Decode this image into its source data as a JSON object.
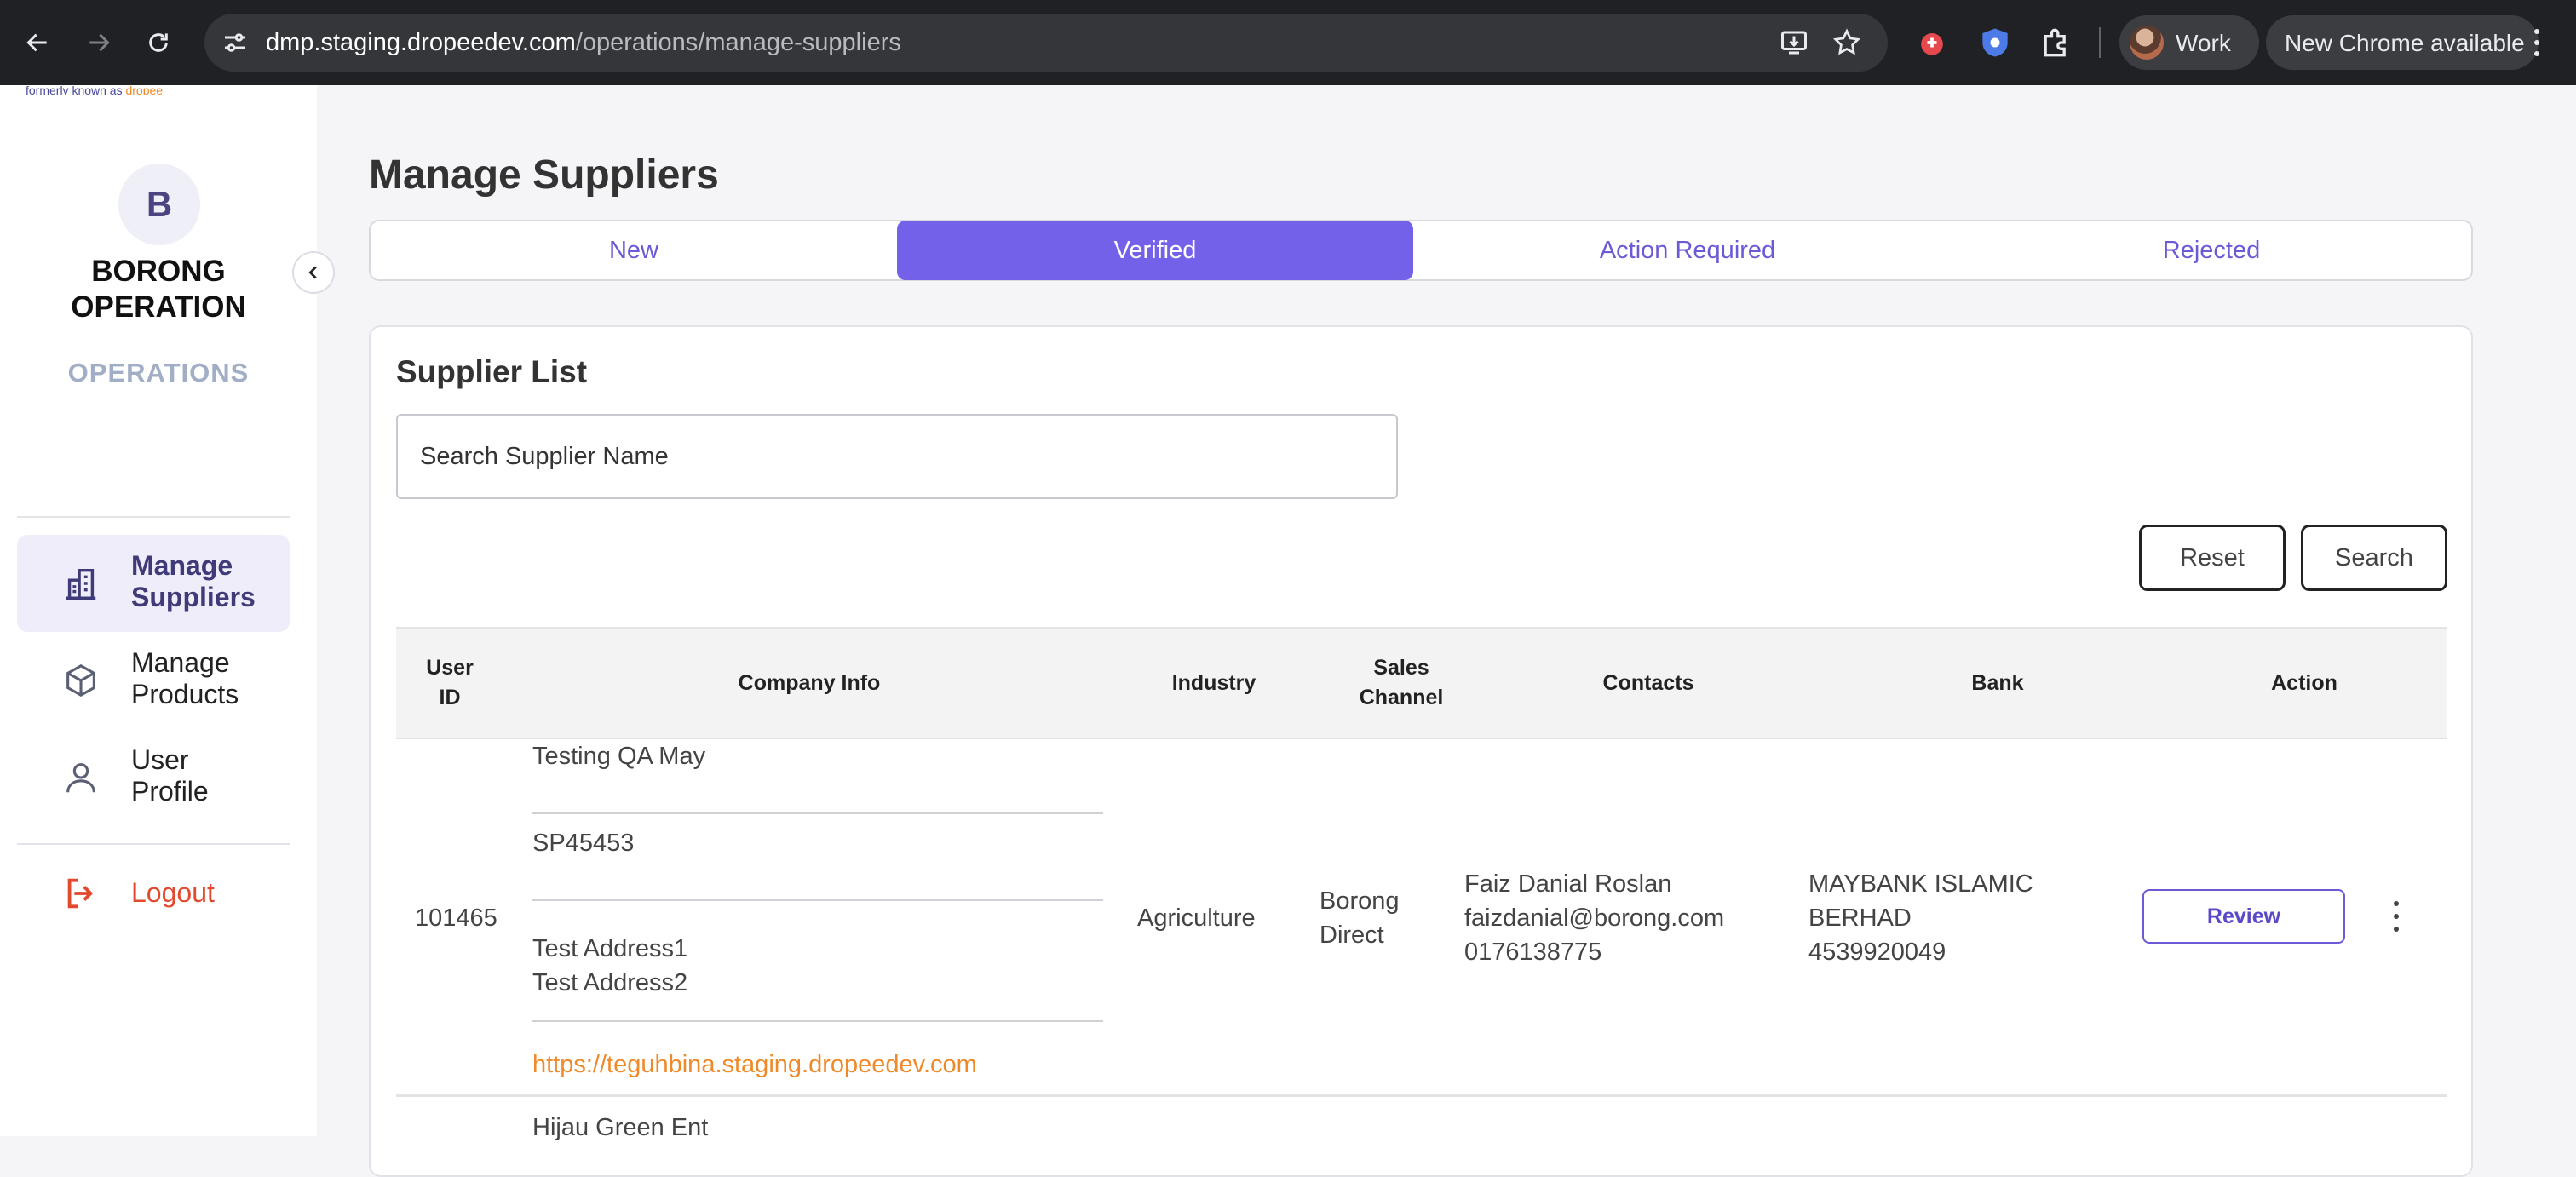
{
  "browser": {
    "url_host": "dmp.staging.dropeedev.com",
    "url_path": "/operations/manage-suppliers",
    "profile_label": "Work",
    "update_label": "New Chrome available"
  },
  "sidebar": {
    "formerly_text": "formerly known as",
    "formerly_brand": "dropee",
    "avatar_letter": "B",
    "org_name_line1": "BORONG",
    "org_name_line2": "OPERATION",
    "org_role": "OPERATIONS",
    "items": [
      {
        "line1": "Manage",
        "line2": "Suppliers",
        "icon": "building-icon",
        "active": true
      },
      {
        "line1": "Manage",
        "line2": "Products",
        "icon": "box-icon",
        "active": false
      },
      {
        "line1": "User",
        "line2": "Profile",
        "icon": "user-icon",
        "active": false
      }
    ],
    "logout_label": "Logout"
  },
  "main": {
    "title": "Manage Suppliers",
    "tabs": [
      "New",
      "Verified",
      "Action Required",
      "Rejected"
    ],
    "active_tab": "Verified",
    "card_title": "Supplier List",
    "search_placeholder": "Search Supplier Name",
    "reset_label": "Reset",
    "search_label": "Search"
  },
  "table": {
    "headers": {
      "user_id_1": "User",
      "user_id_2": "ID",
      "company": "Company Info",
      "industry": "Industry",
      "sales_1": "Sales",
      "sales_2": "Channel",
      "contacts": "Contacts",
      "bank": "Bank",
      "action": "Action"
    },
    "rows": [
      {
        "user_id": "101465",
        "company_name": "Testing QA May",
        "company_code": "SP45453",
        "address_1": "Test Address1",
        "address_2": "Test Address2",
        "website": "https://teguhbina.staging.dropeedev.com",
        "industry": "Agriculture",
        "sales_1": "Borong",
        "sales_2": "Direct",
        "contact_name": "Faiz Danial Roslan",
        "contact_email": "faizdanial@borong.com",
        "contact_phone": "0176138775",
        "bank_1": "MAYBANK ISLAMIC",
        "bank_2": "BERHAD",
        "bank_account": "4539920049",
        "action_label": "Review"
      }
    ],
    "next_row_company": "Hijau Green Ent"
  },
  "colors": {
    "accent": "#7461ea",
    "link": "#ee8a2a",
    "logout": "#e24a2f"
  }
}
